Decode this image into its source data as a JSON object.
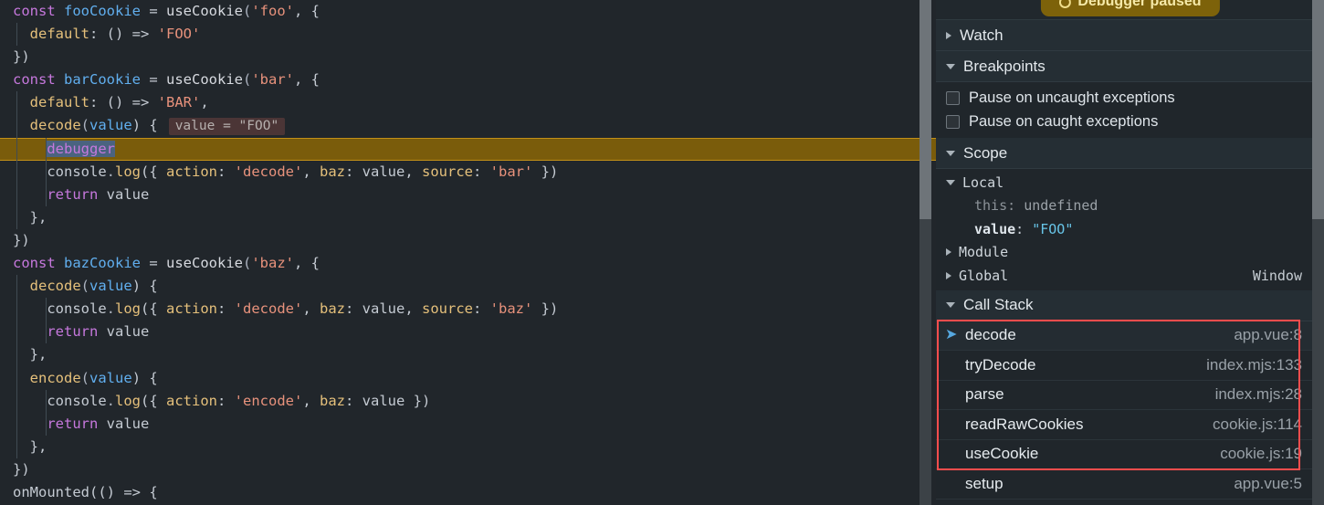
{
  "editor": {
    "language": "vue",
    "lines": [
      {
        "indent": 0,
        "tokens": [
          {
            "t": "const ",
            "c": "kw"
          },
          {
            "t": "fooCookie",
            "c": "var"
          },
          {
            "t": " = ",
            "c": "pl"
          },
          {
            "t": "useCookie",
            "c": "white"
          },
          {
            "t": "(",
            "c": "punc"
          },
          {
            "t": "'foo'",
            "c": "str"
          },
          {
            "t": ", {",
            "c": "pl"
          }
        ]
      },
      {
        "indent": 1,
        "tokens": [
          {
            "t": "  ",
            "c": "pl"
          },
          {
            "t": "default",
            "c": "key"
          },
          {
            "t": ": () => ",
            "c": "pl"
          },
          {
            "t": "'FOO'",
            "c": "str"
          }
        ]
      },
      {
        "indent": 0,
        "tokens": [
          {
            "t": "})",
            "c": "pl"
          }
        ]
      },
      {
        "indent": 0,
        "tokens": [
          {
            "t": "const ",
            "c": "kw"
          },
          {
            "t": "barCookie",
            "c": "var"
          },
          {
            "t": " = ",
            "c": "pl"
          },
          {
            "t": "useCookie",
            "c": "white"
          },
          {
            "t": "(",
            "c": "punc"
          },
          {
            "t": "'bar'",
            "c": "str"
          },
          {
            "t": ", {",
            "c": "pl"
          }
        ]
      },
      {
        "indent": 1,
        "tokens": [
          {
            "t": "  ",
            "c": "pl"
          },
          {
            "t": "default",
            "c": "key"
          },
          {
            "t": ": () => ",
            "c": "pl"
          },
          {
            "t": "'BAR'",
            "c": "str"
          },
          {
            "t": ",",
            "c": "pl"
          }
        ]
      },
      {
        "indent": 1,
        "tokens": [
          {
            "t": "  ",
            "c": "pl"
          },
          {
            "t": "decode",
            "c": "fn"
          },
          {
            "t": "(",
            "c": "punc"
          },
          {
            "t": "value",
            "c": "var"
          },
          {
            "t": ") {",
            "c": "pl"
          }
        ],
        "hint": "value = \"FOO\""
      },
      {
        "indent": 2,
        "highlight": true,
        "tokens": [
          {
            "t": "    ",
            "c": "pl"
          },
          {
            "t": "debugger",
            "c": "sel"
          }
        ]
      },
      {
        "indent": 2,
        "tokens": [
          {
            "t": "    ",
            "c": "pl"
          },
          {
            "t": "console",
            "c": "pl"
          },
          {
            "t": ".",
            "c": "punc"
          },
          {
            "t": "log",
            "c": "fn"
          },
          {
            "t": "({ ",
            "c": "pl"
          },
          {
            "t": "action",
            "c": "key"
          },
          {
            "t": ": ",
            "c": "pl"
          },
          {
            "t": "'decode'",
            "c": "str"
          },
          {
            "t": ", ",
            "c": "pl"
          },
          {
            "t": "baz",
            "c": "key"
          },
          {
            "t": ": value, ",
            "c": "pl"
          },
          {
            "t": "source",
            "c": "key"
          },
          {
            "t": ": ",
            "c": "pl"
          },
          {
            "t": "'bar'",
            "c": "str"
          },
          {
            "t": " })",
            "c": "pl"
          }
        ]
      },
      {
        "indent": 2,
        "tokens": [
          {
            "t": "    ",
            "c": "pl"
          },
          {
            "t": "return",
            "c": "kw"
          },
          {
            "t": " value",
            "c": "pl"
          }
        ]
      },
      {
        "indent": 1,
        "tokens": [
          {
            "t": "  },",
            "c": "pl"
          }
        ]
      },
      {
        "indent": 0,
        "tokens": [
          {
            "t": "})",
            "c": "pl"
          }
        ]
      },
      {
        "indent": 0,
        "tokens": [
          {
            "t": "const ",
            "c": "kw"
          },
          {
            "t": "bazCookie",
            "c": "var"
          },
          {
            "t": " = ",
            "c": "pl"
          },
          {
            "t": "useCookie",
            "c": "white"
          },
          {
            "t": "(",
            "c": "punc"
          },
          {
            "t": "'baz'",
            "c": "str"
          },
          {
            "t": ", {",
            "c": "pl"
          }
        ]
      },
      {
        "indent": 1,
        "tokens": [
          {
            "t": "  ",
            "c": "pl"
          },
          {
            "t": "decode",
            "c": "fn"
          },
          {
            "t": "(",
            "c": "punc"
          },
          {
            "t": "value",
            "c": "var"
          },
          {
            "t": ") {",
            "c": "pl"
          }
        ]
      },
      {
        "indent": 2,
        "tokens": [
          {
            "t": "    ",
            "c": "pl"
          },
          {
            "t": "console",
            "c": "pl"
          },
          {
            "t": ".",
            "c": "punc"
          },
          {
            "t": "log",
            "c": "fn"
          },
          {
            "t": "({ ",
            "c": "pl"
          },
          {
            "t": "action",
            "c": "key"
          },
          {
            "t": ": ",
            "c": "pl"
          },
          {
            "t": "'decode'",
            "c": "str"
          },
          {
            "t": ", ",
            "c": "pl"
          },
          {
            "t": "baz",
            "c": "key"
          },
          {
            "t": ": value, ",
            "c": "pl"
          },
          {
            "t": "source",
            "c": "key"
          },
          {
            "t": ": ",
            "c": "pl"
          },
          {
            "t": "'baz'",
            "c": "str"
          },
          {
            "t": " })",
            "c": "pl"
          }
        ]
      },
      {
        "indent": 2,
        "tokens": [
          {
            "t": "    ",
            "c": "pl"
          },
          {
            "t": "return",
            "c": "kw"
          },
          {
            "t": " value",
            "c": "pl"
          }
        ]
      },
      {
        "indent": 1,
        "tokens": [
          {
            "t": "  },",
            "c": "pl"
          }
        ]
      },
      {
        "indent": 1,
        "tokens": [
          {
            "t": "  ",
            "c": "pl"
          },
          {
            "t": "encode",
            "c": "fn"
          },
          {
            "t": "(",
            "c": "punc"
          },
          {
            "t": "value",
            "c": "var"
          },
          {
            "t": ") {",
            "c": "pl"
          }
        ]
      },
      {
        "indent": 2,
        "tokens": [
          {
            "t": "    ",
            "c": "pl"
          },
          {
            "t": "console",
            "c": "pl"
          },
          {
            "t": ".",
            "c": "punc"
          },
          {
            "t": "log",
            "c": "fn"
          },
          {
            "t": "({ ",
            "c": "pl"
          },
          {
            "t": "action",
            "c": "key"
          },
          {
            "t": ": ",
            "c": "pl"
          },
          {
            "t": "'encode'",
            "c": "str"
          },
          {
            "t": ", ",
            "c": "pl"
          },
          {
            "t": "baz",
            "c": "key"
          },
          {
            "t": ": value })",
            "c": "pl"
          }
        ]
      },
      {
        "indent": 2,
        "tokens": [
          {
            "t": "    ",
            "c": "pl"
          },
          {
            "t": "return",
            "c": "kw"
          },
          {
            "t": " value",
            "c": "pl"
          }
        ]
      },
      {
        "indent": 1,
        "tokens": [
          {
            "t": "  },",
            "c": "pl"
          }
        ]
      },
      {
        "indent": 0,
        "tokens": [
          {
            "t": "})",
            "c": "pl"
          }
        ]
      },
      {
        "indent": 0,
        "tokens": [
          {
            "t": "onMounted",
            "c": "pl"
          },
          {
            "t": "(() => {",
            "c": "pl"
          }
        ]
      }
    ]
  },
  "sidebar": {
    "paused_badge": "Debugger paused",
    "sections": {
      "watch": {
        "label": "Watch",
        "expanded": false
      },
      "breakpoints": {
        "label": "Breakpoints",
        "expanded": true,
        "options": [
          {
            "label": "Pause on uncaught exceptions",
            "checked": false
          },
          {
            "label": "Pause on caught exceptions",
            "checked": false
          }
        ]
      },
      "scope": {
        "label": "Scope",
        "expanded": true,
        "entries": [
          {
            "name": "Local",
            "expanded": true,
            "kind": "group"
          },
          {
            "name": "this",
            "value": "undefined",
            "kind": "prop-dim"
          },
          {
            "name": "value",
            "value": "\"FOO\"",
            "kind": "prop-str"
          },
          {
            "name": "Module",
            "expanded": false,
            "kind": "group"
          },
          {
            "name": "Global",
            "expanded": false,
            "kind": "group",
            "right": "Window"
          }
        ]
      },
      "call_stack": {
        "label": "Call Stack",
        "expanded": true,
        "frames": [
          {
            "name": "decode",
            "location": "app.vue:8",
            "active": true
          },
          {
            "name": "tryDecode",
            "location": "index.mjs:133",
            "active": false
          },
          {
            "name": "parse",
            "location": "index.mjs:28",
            "active": false
          },
          {
            "name": "readRawCookies",
            "location": "cookie.js:114",
            "active": false
          },
          {
            "name": "useCookie",
            "location": "cookie.js:19",
            "active": false
          },
          {
            "name": "setup",
            "location": "app.vue:5",
            "active": false
          }
        ]
      }
    }
  },
  "annotations": {
    "call_stack_highlight_color": "#ff4d4d"
  },
  "colors": {
    "editor_bg": "#21262b",
    "sidebar_bg": "#20262b",
    "section_header_bg": "#252e34",
    "debug_line_highlight": "#7a5c0b",
    "paused_badge_bg": "#7d620a",
    "accent_blue": "#56a8e0",
    "annotation_red": "#ff4d4d"
  }
}
